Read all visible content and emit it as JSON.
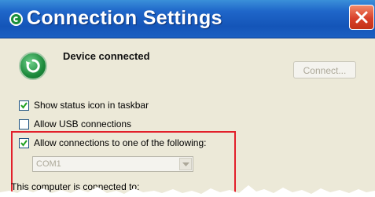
{
  "window": {
    "title": "Connection Settings",
    "close_icon": "close-icon",
    "app_icon": "sync-icon"
  },
  "device": {
    "status_text": "Device connected",
    "status_icon": "sync-icon",
    "connect_button_label": "Connect...",
    "connect_button_enabled": false
  },
  "options": [
    {
      "label": "Show status icon in taskbar",
      "checked": true
    },
    {
      "label": "Allow USB connections",
      "checked": false
    },
    {
      "label": "Allow connections to one of the following:",
      "checked": true
    }
  ],
  "port_select": {
    "value": "COM1",
    "enabled": false
  },
  "footer": {
    "connected_to_label": "This computer is connected to:"
  },
  "colors": {
    "titlebar": "#1455b8",
    "dialog_background": "#ece9d8",
    "highlight_border": "#e2202a",
    "close_button": "#d8402a"
  }
}
